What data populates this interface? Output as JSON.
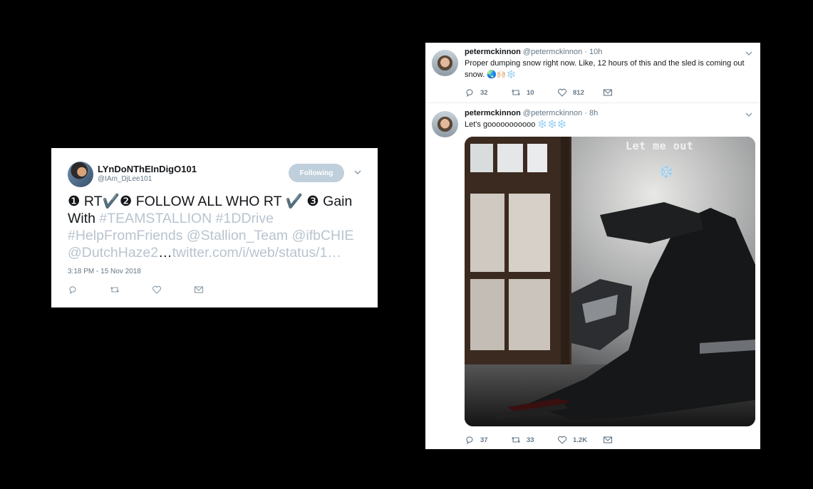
{
  "left_tweet": {
    "name": "LYnDoNThEInDigO101",
    "handle": "@IAm_DjLee101",
    "follow_label": "Following",
    "body_plain_1": "❶ RT✔️❷ FOLLOW ALL WHO RT ✔️ ❸ Gain With ",
    "body_tag_1": "#TEAMSTALLION #1DDrive #HelpFromFriends @Stallion_Team @ifbCHIE @DutchHaze2",
    "body_ellipsis": "…",
    "body_link": "twitter.com/i/web/status/1…",
    "timestamp": "3:18 PM - 15 Nov 2018",
    "icons": [
      "reply-icon",
      "retweet-icon",
      "like-icon",
      "message-icon"
    ]
  },
  "timeline": {
    "tweets": [
      {
        "name": "petermckinnon",
        "handle": "@petermckinnon",
        "sep": " · ",
        "time": "10h",
        "text": "Proper dumping snow right now. Like, 12 hours of this and the sled is coming out snow. 🌏🙌🏻❄️",
        "replies": "32",
        "retweets": "10",
        "likes": "812"
      },
      {
        "name": "petermckinnon",
        "handle": "@petermckinnon",
        "sep": " · ",
        "time": "8h",
        "text": "Let's gooooooooooo ❄️❄️❄️",
        "media_caption": "Let me out",
        "media_emoji": "❄️",
        "replies": "37",
        "retweets": "33",
        "likes": "1.2K"
      }
    ]
  },
  "colors": {
    "background": "#000000",
    "card": "#ffffff",
    "hashtag_faded": "#b8c4cf",
    "muted": "#657786",
    "follow_button": "#bfcfdb"
  }
}
